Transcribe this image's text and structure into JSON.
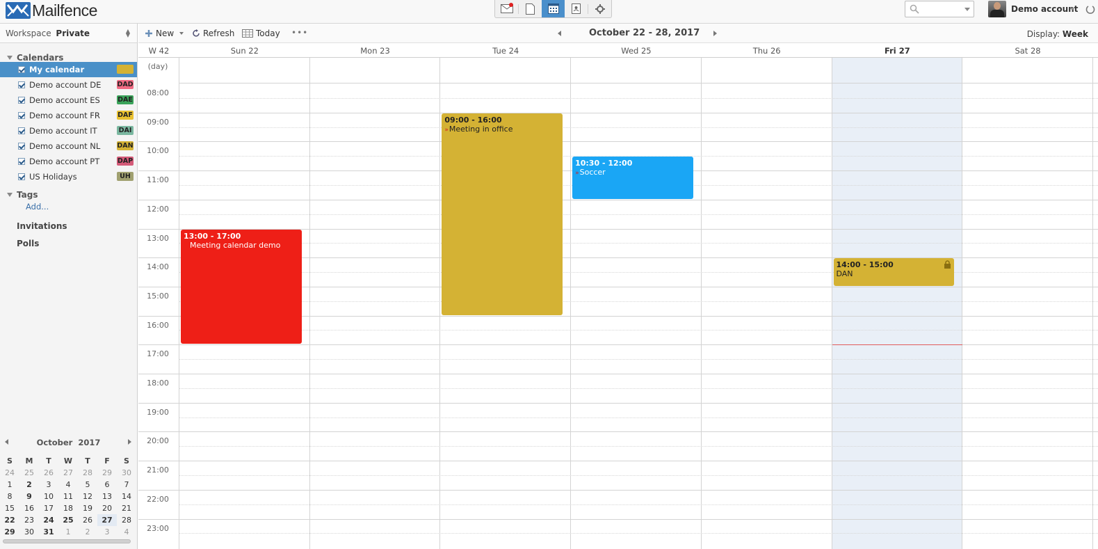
{
  "app": {
    "logo_text": "Mailfence",
    "account_name": "Demo account"
  },
  "toolbar": {
    "new_label": "New",
    "refresh_label": "Refresh",
    "today_label": "Today",
    "more_label": "•••",
    "range_label": "October 22 - 28, 2017",
    "display_label": "Display:",
    "display_value": "Week"
  },
  "sidebar": {
    "workspace_label": "Workspace",
    "workspace_value": "Private",
    "calendars_header": "Calendars",
    "calendars": [
      {
        "name": "My calendar",
        "tag": "",
        "color": "#d4b234"
      },
      {
        "name": "Demo account DE",
        "tag": "DAD",
        "color": "#f06a82"
      },
      {
        "name": "Demo account ES",
        "tag": "DAE",
        "color": "#3aa35a"
      },
      {
        "name": "Demo account FR",
        "tag": "DAF",
        "color": "#e8c030"
      },
      {
        "name": "Demo account IT",
        "tag": "DAI",
        "color": "#7ab7a0"
      },
      {
        "name": "Demo account NL",
        "tag": "DAN",
        "color": "#d4b234"
      },
      {
        "name": "Demo account PT",
        "tag": "DAP",
        "color": "#d45a78"
      },
      {
        "name": "US Holidays",
        "tag": "UH",
        "color": "#a0a070"
      }
    ],
    "tags_header": "Tags",
    "tags_add": "Add...",
    "invitations_label": "Invitations",
    "polls_label": "Polls"
  },
  "mini_calendar": {
    "month": "October",
    "year": "2017",
    "weekday_headers": [
      "S",
      "M",
      "T",
      "W",
      "T",
      "F",
      "S"
    ],
    "weeks": [
      [
        "24",
        "25",
        "26",
        "27",
        "28",
        "29",
        "30"
      ],
      [
        "1",
        "2",
        "3",
        "4",
        "5",
        "6",
        "7"
      ],
      [
        "8",
        "9",
        "10",
        "11",
        "12",
        "13",
        "14"
      ],
      [
        "15",
        "16",
        "17",
        "18",
        "19",
        "20",
        "21"
      ],
      [
        "22",
        "23",
        "24",
        "25",
        "26",
        "27",
        "28"
      ],
      [
        "29",
        "30",
        "31",
        "1",
        "2",
        "3",
        "4"
      ]
    ]
  },
  "week": {
    "week_label": "W 42",
    "days": [
      "Sun 22",
      "Mon 23",
      "Tue 24",
      "Wed 25",
      "Thu 26",
      "Fri 27",
      "Sat 28"
    ],
    "today_index": 5,
    "allday_label": "(day)",
    "hours": [
      "08:00",
      "09:00",
      "10:00",
      "11:00",
      "12:00",
      "13:00",
      "14:00",
      "15:00",
      "16:00",
      "17:00",
      "18:00",
      "19:00",
      "20:00",
      "21:00",
      "22:00",
      "23:00"
    ],
    "now_time": "17:00"
  },
  "events": [
    {
      "time": "13:00 - 17:00",
      "title": "Meeting calendar demo",
      "day": 0,
      "start": 13,
      "end": 17,
      "color": "#ee1f17",
      "text_color": "#ffffff",
      "arrow": false
    },
    {
      "time": "09:00 - 16:00",
      "title": "Meeting in office",
      "day": 2,
      "start": 9,
      "end": 16,
      "color": "#d4b234",
      "text_color": "#222222",
      "arrow": true
    },
    {
      "time": "10:30 - 12:00",
      "title": "Soccer",
      "day": 3,
      "start": 10.5,
      "end": 12,
      "color": "#1aa6f5",
      "text_color": "#ffffff",
      "arrow": true
    },
    {
      "time": "14:00 - 15:00",
      "title": "DAN",
      "day": 5,
      "start": 14,
      "end": 15,
      "color": "#d4b234",
      "text_color": "#222222",
      "arrow": false,
      "locked": true
    }
  ]
}
